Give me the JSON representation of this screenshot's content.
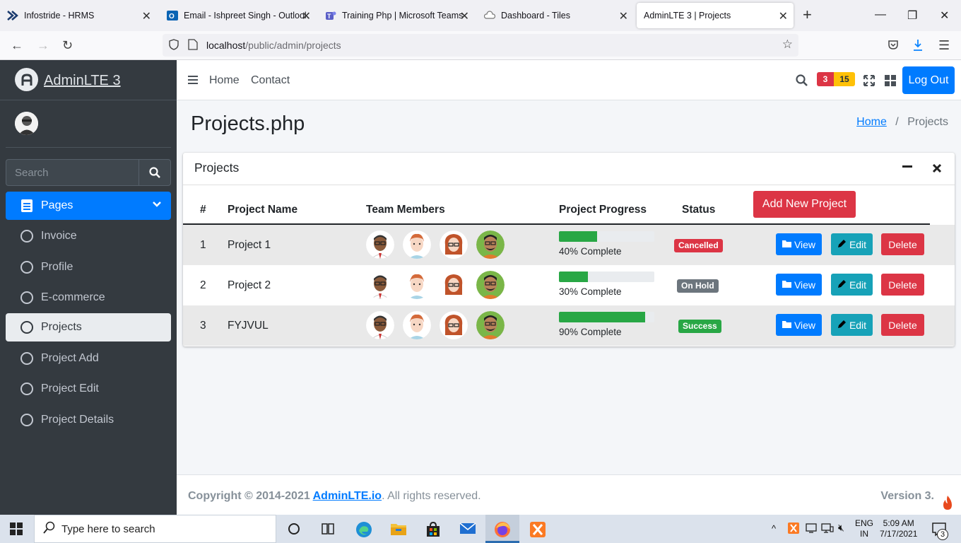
{
  "browser": {
    "tabs": [
      {
        "title": "Infostride - HRMS",
        "active": false
      },
      {
        "title": "Email - Ishpreet Singh - Outlook",
        "active": false
      },
      {
        "title": "Training Php | Microsoft Teams",
        "active": false
      },
      {
        "title": "Dashboard - Tiles",
        "active": false
      },
      {
        "title": "AdminLTE 3 | Projects",
        "active": true
      }
    ],
    "url_host": "localhost",
    "url_path": "/public/admin/projects"
  },
  "sidebar": {
    "brand": "AdminLTE 3",
    "search_placeholder": "Search",
    "pages_label": "Pages",
    "items": [
      {
        "label": "Invoice",
        "active": false
      },
      {
        "label": "Profile",
        "active": false
      },
      {
        "label": "E-commerce",
        "active": false
      },
      {
        "label": "Projects",
        "active": true
      },
      {
        "label": "Project Add",
        "active": false
      },
      {
        "label": "Project Edit",
        "active": false
      },
      {
        "label": "Project Details",
        "active": false
      }
    ]
  },
  "topnav": {
    "home": "Home",
    "contact": "Contact",
    "badge_messages": "3",
    "badge_notifications": "15",
    "logout": "Log Out"
  },
  "page": {
    "title": "Projects.php",
    "breadcrumb_home": "Home",
    "breadcrumb_sep": "/",
    "breadcrumb_current": "Projects"
  },
  "card": {
    "title": "Projects",
    "add_button": "Add New Project",
    "headers": [
      "#",
      "Project Name",
      "Team Members",
      "Project Progress",
      "Status"
    ],
    "rows": [
      {
        "num": "1",
        "name": "Project 1",
        "progress": 40,
        "progress_text": "40% Complete",
        "status": "Cancelled",
        "status_color": "#dc3545"
      },
      {
        "num": "2",
        "name": "Project 2",
        "progress": 30,
        "progress_text": "30% Complete",
        "status": "On Hold",
        "status_color": "#6c757d"
      },
      {
        "num": "3",
        "name": "FYJVUL",
        "progress": 90,
        "progress_text": "90% Complete",
        "status": "Success",
        "status_color": "#28a745"
      }
    ],
    "view_label": "View",
    "edit_label": "Edit",
    "delete_label": "Delete"
  },
  "footer": {
    "copyright": "Copyright © 2014-2021",
    "link": "AdminLTE.io",
    "rest": ". All rights reserved.",
    "version": "Version 3."
  },
  "taskbar": {
    "search_placeholder": "Type here to search",
    "lang_top": "ENG",
    "lang_bottom": "IN",
    "time": "5:09 AM",
    "date": "7/17/2021",
    "notif_count": "3"
  }
}
